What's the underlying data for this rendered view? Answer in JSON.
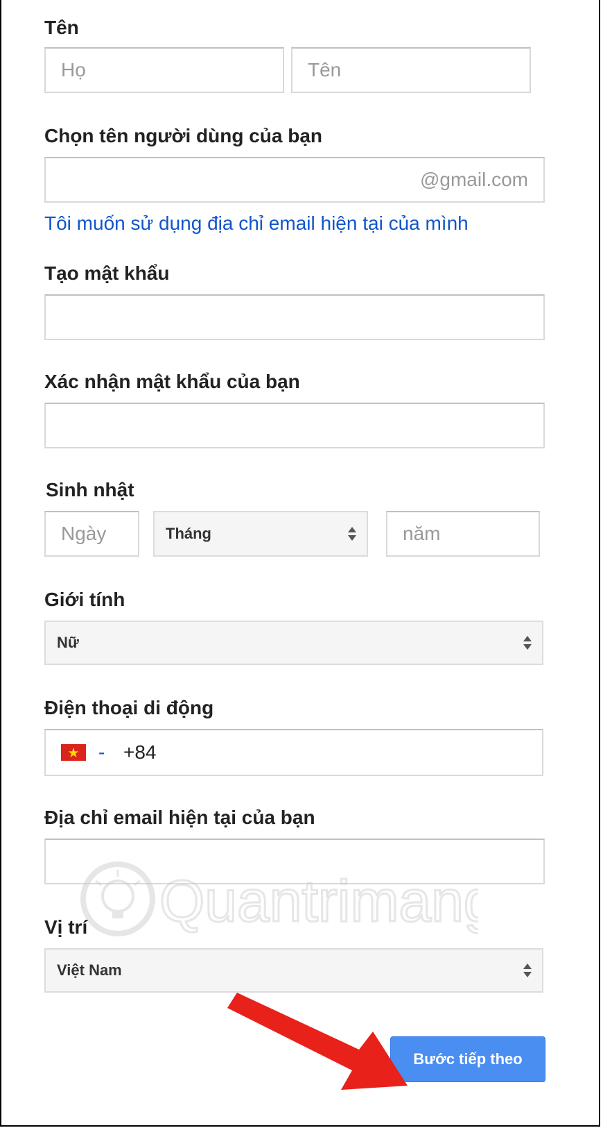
{
  "name": {
    "label": "Tên",
    "last_placeholder": "Họ",
    "first_placeholder": "Tên"
  },
  "username": {
    "label": "Chọn tên người dùng của bạn",
    "suffix": "@gmail.com",
    "link": "Tôi muốn sử dụng địa chỉ email hiện tại của mình"
  },
  "password": {
    "label": "Tạo mật khẩu"
  },
  "confirm_password": {
    "label": "Xác nhận mật khẩu của bạn"
  },
  "birthday": {
    "label": "Sinh nhật",
    "day_placeholder": "Ngày",
    "month_value": "Tháng",
    "year_placeholder": "năm"
  },
  "gender": {
    "label": "Giới tính",
    "value": "Nữ"
  },
  "mobile": {
    "label": "Điện thoại di động",
    "country_flag": "vietnam-flag",
    "separator": "-",
    "code": "+84"
  },
  "current_email": {
    "label": "Địa chỉ email hiện tại của bạn"
  },
  "location": {
    "label": "Vị trí",
    "value": "Việt Nam"
  },
  "next_button": {
    "label": "Bước tiếp theo",
    "color": "#4a8ef2"
  },
  "watermark": {
    "text": "Quantrimang"
  },
  "annotation": {
    "arrow_color": "#e8211b"
  }
}
